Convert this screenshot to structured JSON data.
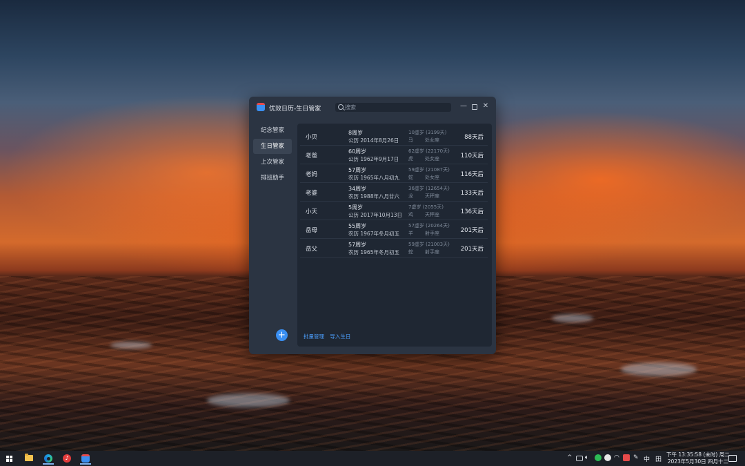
{
  "window": {
    "title": "优效日历-生日管家",
    "search_placeholder": "搜索",
    "minimize_glyph": "—",
    "close_glyph": "✕"
  },
  "sidebar": {
    "items": [
      {
        "label": "纪念管家",
        "active": false
      },
      {
        "label": "生日管家",
        "active": true
      },
      {
        "label": "上次管家",
        "active": false
      },
      {
        "label": "排班助手",
        "active": false
      }
    ],
    "add_glyph": "+"
  },
  "birthdays": [
    {
      "name": "小贝",
      "age": "8周岁",
      "date": "公历 2014年8月26日",
      "next": "10虚岁 (3199天)",
      "zodiac": "马",
      "sign": "处女座",
      "days": "88天后"
    },
    {
      "name": "老爸",
      "age": "60周岁",
      "date": "公历 1962年9月17日",
      "next": "62虚岁 (22170天)",
      "zodiac": "虎",
      "sign": "处女座",
      "days": "110天后"
    },
    {
      "name": "老妈",
      "age": "57周岁",
      "date": "农历 1965年八月初九",
      "next": "59虚岁 (21087天)",
      "zodiac": "蛇",
      "sign": "处女座",
      "days": "116天后"
    },
    {
      "name": "老婆",
      "age": "34周岁",
      "date": "农历 1988年八月廿六",
      "next": "36虚岁 (12654天)",
      "zodiac": "龙",
      "sign": "天秤座",
      "days": "133天后"
    },
    {
      "name": "小天",
      "age": "5周岁",
      "date": "公历 2017年10月13日",
      "next": "7虚岁 (2055天)",
      "zodiac": "鸡",
      "sign": "天秤座",
      "days": "136天后"
    },
    {
      "name": "岳母",
      "age": "55周岁",
      "date": "农历 1967年冬月初五",
      "next": "57虚岁 (20264天)",
      "zodiac": "羊",
      "sign": "射手座",
      "days": "201天后"
    },
    {
      "name": "岳父",
      "age": "57周岁",
      "date": "农历 1965年冬月初五",
      "next": "59虚岁 (21003天)",
      "zodiac": "蛇",
      "sign": "射手座",
      "days": "201天后"
    }
  ],
  "footer": {
    "batch_label": "批量管理",
    "import_label": "导入生日"
  },
  "taskbar": {
    "tray_caret": "^",
    "ime_label": "中",
    "grid_label": "田",
    "clock_line1": "下午 13:35:58 (未时) 周二",
    "clock_line2": "2023年5月30日 四月十二"
  }
}
